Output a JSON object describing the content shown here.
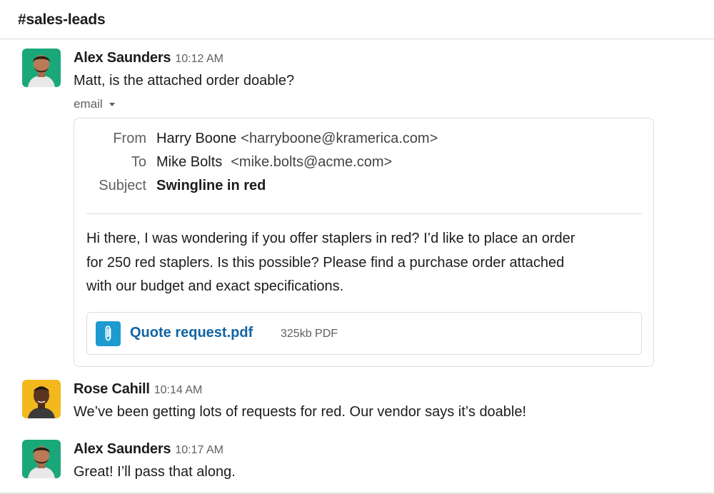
{
  "channel": {
    "name": "#sales-leads"
  },
  "messages": [
    {
      "author": "Alex Saunders",
      "time": "10:12 AM",
      "text": "Matt, is the attached order doable?",
      "avatar_bg": "#1aa87a"
    },
    {
      "author": "Rose Cahill",
      "time": "10:14 AM",
      "text": "We’ve been getting lots of requests for red. Our vendor says it’s doable!",
      "avatar_bg": "#f2b81e"
    },
    {
      "author": "Alex Saunders",
      "time": "10:17 AM",
      "text": "Great! I’ll pass that along.",
      "avatar_bg": "#1aa87a"
    }
  ],
  "email": {
    "toggle_label": "email",
    "from_label": "From",
    "from_name": "Harry Boone",
    "from_email": "<harryboone@kramerica.com>",
    "to_label": "To",
    "to_name": "Mike Bolts",
    "to_email": "<mike.bolts@acme.com>",
    "subject_label": "Subject",
    "subject": "Swingline in red",
    "body_lines": [
      "Hi there, I was wondering if you offer staplers in red? I’d like to place an order",
      "for 250 red staplers. Is this possible? Please find a purchase order attached",
      "with our budget and exact specifications."
    ],
    "attachment": {
      "name": "Quote request.pdf",
      "meta": "325kb PDF",
      "icon": "paperclip-icon",
      "icon_color": "#1d9bd1"
    }
  },
  "colors": {
    "link": "#1264a3",
    "muted": "#616061",
    "border": "#dddddd"
  }
}
